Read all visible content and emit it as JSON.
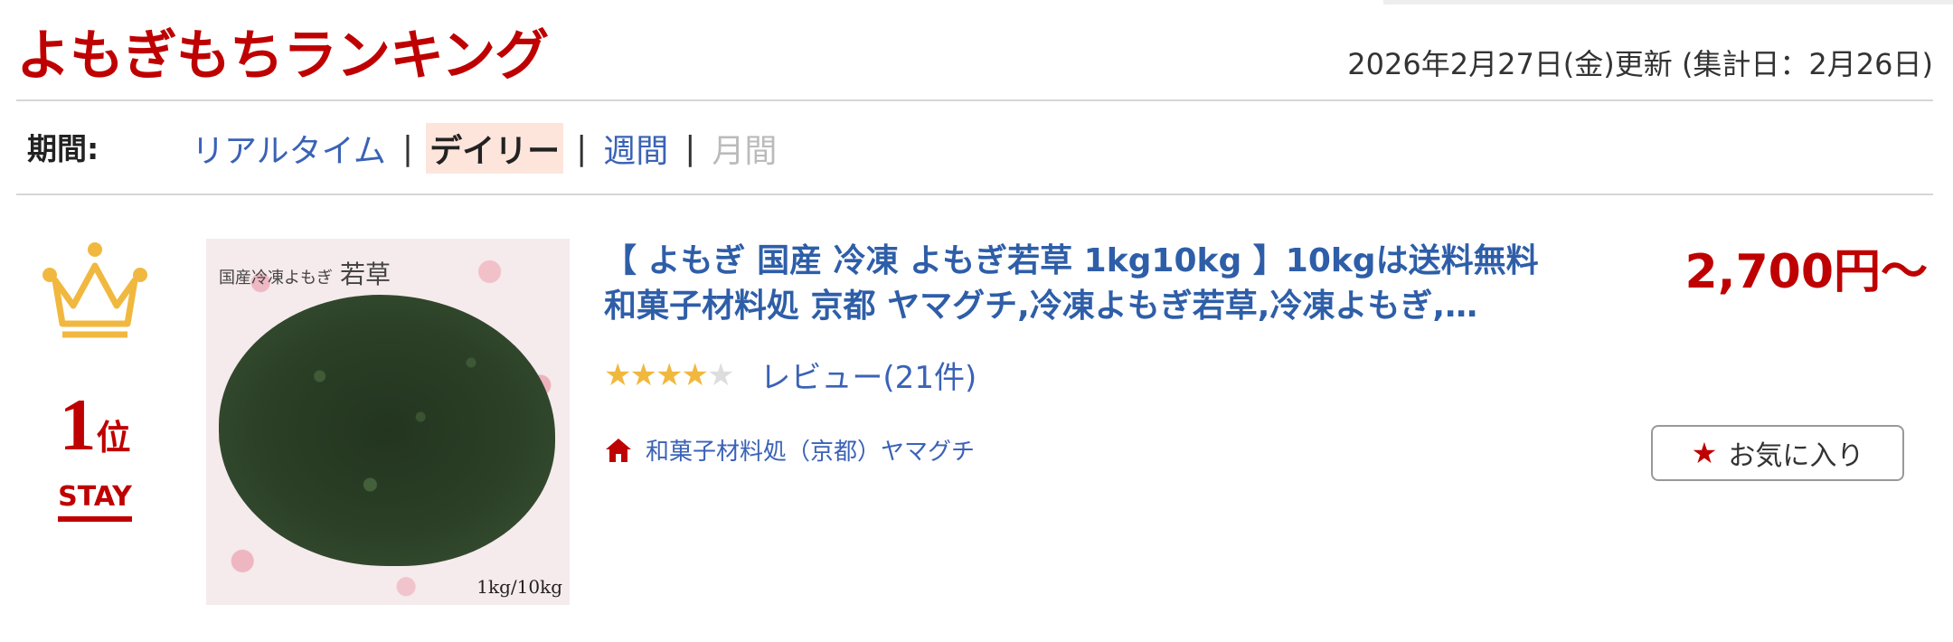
{
  "header": {
    "title": "よもぎもちランキング",
    "updated": "2026年2月27日(金)更新 (集計日：2月26日)"
  },
  "period": {
    "label": "期間:",
    "tabs": [
      {
        "label": "リアルタイム",
        "state": "link"
      },
      {
        "label": "デイリー",
        "state": "active"
      },
      {
        "label": "週間",
        "state": "link"
      },
      {
        "label": "月間",
        "state": "disabled"
      }
    ],
    "separator": "|"
  },
  "item": {
    "rank_number": "1",
    "rank_unit": "位",
    "rank_change": "STAY",
    "image_caption_small": "国産冷凍よもぎ",
    "image_caption_large": "若草",
    "image_weight": "1kg/10kg",
    "title": "【 よもぎ 国産 冷凍 よもぎ若草 1kg10kg 】10kgは送料無料 和菓子材料処 京都 ヤマグチ,冷凍よもぎ若草,冷凍よもぎ,…",
    "rating": 4,
    "rating_max": 5,
    "review_text": "レビュー(21件)",
    "shop_name": "和菓子材料処（京都）ヤマグチ",
    "price": "2,700円〜",
    "favorite_label": "お気に入り"
  },
  "colors": {
    "accent": "#bf0000",
    "link": "#3a62b6",
    "star": "#f1b83f",
    "active_tab_bg": "#fde5dc"
  },
  "icons": {
    "rank": "crown-icon",
    "shop": "house-icon",
    "favorite": "star-icon"
  }
}
